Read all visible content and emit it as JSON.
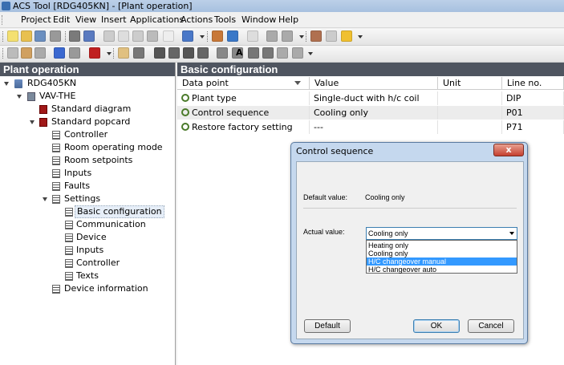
{
  "window": {
    "title": "ACS Tool [RDG405KN] - [Plant operation]"
  },
  "menu": [
    "Project",
    "Edit",
    "View",
    "Insert",
    "Applications",
    "Actions",
    "Tools",
    "Window",
    "Help"
  ],
  "toolbar": {
    "text_icon": "A"
  },
  "left_panel": {
    "title": "Plant operation",
    "tree": [
      {
        "label": "RDG405KN",
        "icon": "network-icon"
      },
      {
        "label": "VAV-THE",
        "icon": "device-icon"
      },
      {
        "label": "Standard diagram",
        "icon": "diagram-icon"
      },
      {
        "label": "Standard popcard",
        "icon": "popcard-icon"
      },
      {
        "label": "Controller",
        "icon": "list-icon"
      },
      {
        "label": "Room operating mode",
        "icon": "list-icon"
      },
      {
        "label": "Room setpoints",
        "icon": "list-icon"
      },
      {
        "label": "Inputs",
        "icon": "list-icon"
      },
      {
        "label": "Faults",
        "icon": "list-icon"
      },
      {
        "label": "Settings",
        "icon": "list-icon"
      },
      {
        "label": "Basic configuration",
        "icon": "list-icon"
      },
      {
        "label": "Communication",
        "icon": "list-icon"
      },
      {
        "label": "Device",
        "icon": "list-icon"
      },
      {
        "label": "Inputs",
        "icon": "list-icon"
      },
      {
        "label": "Controller",
        "icon": "list-icon"
      },
      {
        "label": "Texts",
        "icon": "list-icon"
      },
      {
        "label": "Device information",
        "icon": "list-icon"
      }
    ]
  },
  "right_panel": {
    "title": "Basic configuration",
    "columns": [
      "Data point",
      "Value",
      "Unit",
      "Line no."
    ],
    "rows": [
      {
        "point": "Plant type",
        "value": "Single-duct with h/c coil",
        "unit": "",
        "line": "DIP"
      },
      {
        "point": "Control sequence",
        "value": "Cooling only",
        "unit": "",
        "line": "P01"
      },
      {
        "point": "Restore factory setting",
        "value": "---",
        "unit": "",
        "line": "P71"
      }
    ]
  },
  "dialog": {
    "title": "Control sequence",
    "close_label": "x",
    "default_label": "Default value:",
    "default_value": "Cooling only",
    "actual_label": "Actual value:",
    "actual_value": "Cooling only",
    "options": [
      "Heating only",
      "Cooling only",
      "H/C changeover manual",
      "H/C changeover auto"
    ],
    "selected_option": "H/C changeover manual",
    "buttons": {
      "default": "Default",
      "ok": "OK",
      "cancel": "Cancel"
    }
  }
}
